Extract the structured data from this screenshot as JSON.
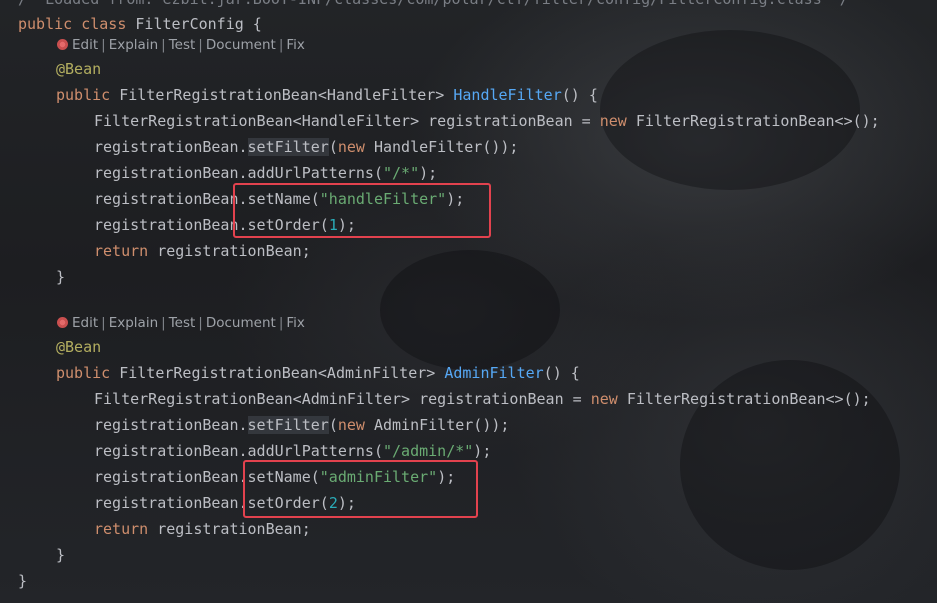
{
  "editor": {
    "colors": {
      "keyword": "#cf8e6d",
      "annotation": "#b3ae60",
      "method_declaration": "#56a8f5",
      "string": "#6aab73",
      "number": "#2aacb8",
      "comment": "#7a7e85",
      "default_text": "#bcbec4",
      "highlight_box": "#e2424e"
    },
    "comment_top": "/* Loaded from: ezbit.jar:BOOT-INF/classes/com/polar/ctf/filter/config/FilterConfig.class */",
    "class_decl": {
      "kw_public": "public",
      "kw_class": "class",
      "name": "FilterConfig",
      "open": " {"
    },
    "code_lens": {
      "icon": "bean-icon",
      "items": [
        "Edit",
        "Explain",
        "Test",
        "Document",
        "Fix"
      ]
    },
    "methods": [
      {
        "annotation": "@Bean",
        "kw_public": "public",
        "return_type": "FilterRegistrationBean<HandleFilter>",
        "name": "HandleFilter",
        "params_open": "() {",
        "decl_type": "FilterRegistrationBean<HandleFilter> registrationBean = ",
        "kw_new": "new",
        "decl_ctor": "FilterRegistrationBean<>();",
        "setfilter_prefix": "registrationBean.",
        "setfilter_method": "setFilter",
        "setfilter_open": "(",
        "setfilter_new": "new",
        "setfilter_rest": " HandleFilter());",
        "urls_prefix": "registrationBean.addUrlPatterns(",
        "urls_value": "\"/*\"",
        "urls_suffix": ");",
        "name_prefix": "registrationBean.setName(",
        "name_value": "\"handleFilter\"",
        "name_suffix": ");",
        "order_prefix": "registrationBean.setOrder(",
        "order_value": "1",
        "order_suffix": ");",
        "kw_return": "return",
        "return_rest": " registrationBean;",
        "close": "}"
      },
      {
        "annotation": "@Bean",
        "kw_public": "public",
        "return_type": "FilterRegistrationBean<AdminFilter>",
        "name": "AdminFilter",
        "params_open": "() {",
        "decl_type": "FilterRegistrationBean<AdminFilter> registrationBean = ",
        "kw_new": "new",
        "decl_ctor": "FilterRegistrationBean<>();",
        "setfilter_prefix": "registrationBean.",
        "setfilter_method": "setFilter",
        "setfilter_open": "(",
        "setfilter_new": "new",
        "setfilter_rest": " AdminFilter());",
        "urls_prefix": "registrationBean.addUrlPatterns(",
        "urls_value": "\"/admin/*\"",
        "urls_suffix": ");",
        "name_prefix": "registrationBean.setName(",
        "name_value": "\"adminFilter\"",
        "name_suffix": ");",
        "order_prefix": "registrationBean.setOrder(",
        "order_value": "2",
        "order_suffix": ");",
        "kw_return": "return",
        "return_rest": " registrationBean;",
        "close": "}"
      }
    ],
    "class_close": "}"
  }
}
